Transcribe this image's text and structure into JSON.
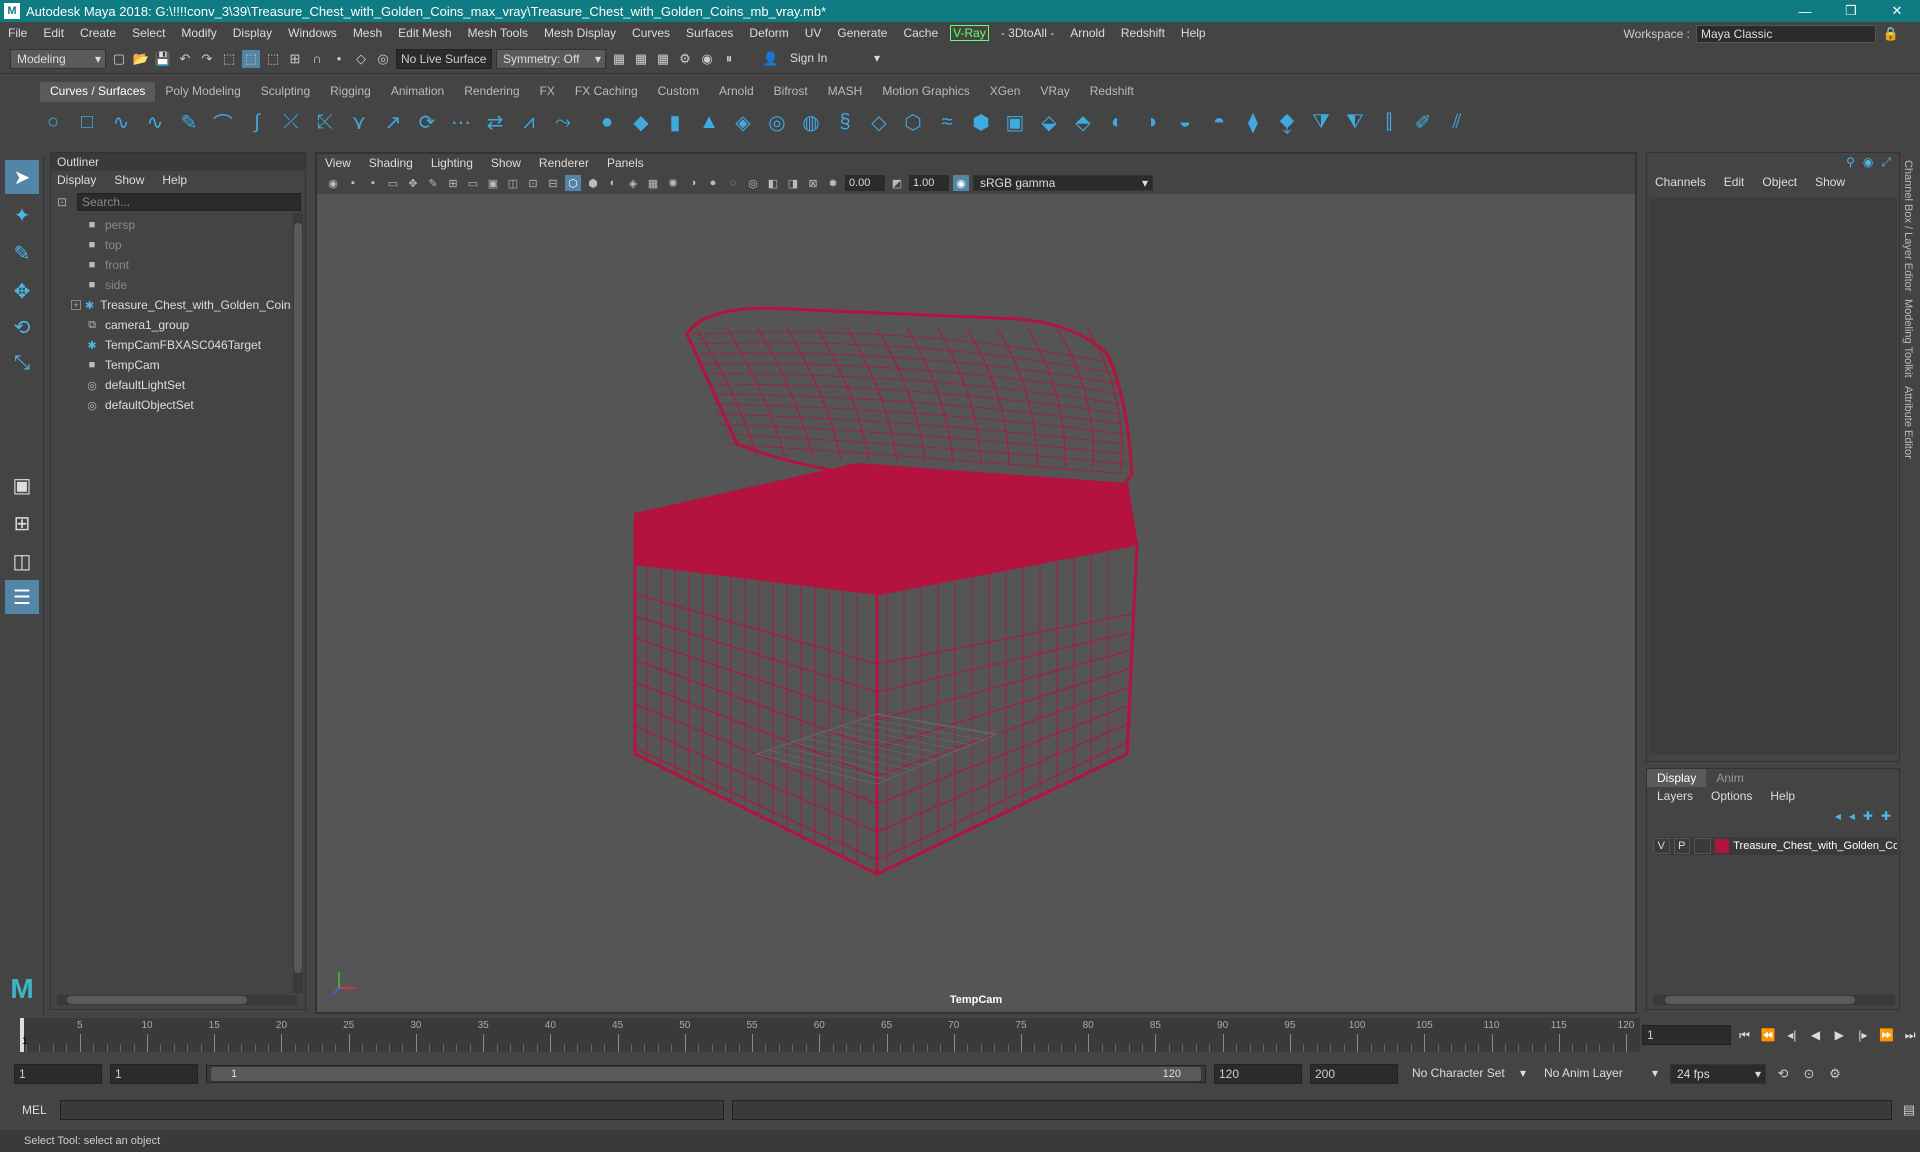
{
  "title": "Autodesk Maya 2018: G:\\!!!!conv_3\\39\\Treasure_Chest_with_Golden_Coins_max_vray\\Treasure_Chest_with_Golden_Coins_mb_vray.mb*",
  "menu": [
    "File",
    "Edit",
    "Create",
    "Select",
    "Modify",
    "Display",
    "Windows",
    "Mesh",
    "Edit Mesh",
    "Mesh Tools",
    "Mesh Display",
    "Curves",
    "Surfaces",
    "Deform",
    "UV",
    "Generate",
    "Cache",
    "V-Ray",
    "- 3DtoAll -",
    "Arnold",
    "Redshift",
    "Help"
  ],
  "workspace": {
    "label": "Workspace :",
    "value": "Maya Classic"
  },
  "status": {
    "mode": "Modeling",
    "live_surface": "No Live Surface",
    "symmetry": "Symmetry: Off",
    "sign_in": "Sign In"
  },
  "shelf_tabs": [
    "Curves / Surfaces",
    "Poly Modeling",
    "Sculpting",
    "Rigging",
    "Animation",
    "Rendering",
    "FX",
    "FX Caching",
    "Custom",
    "Arnold",
    "Bifrost",
    "MASH",
    "Motion Graphics",
    "XGen",
    "VRay",
    "Redshift"
  ],
  "outliner": {
    "title": "Outliner",
    "menus": [
      "Display",
      "Show",
      "Help"
    ],
    "search_placeholder": "Search...",
    "items": [
      {
        "label": "persp",
        "icon": "camera-icon",
        "dim": true
      },
      {
        "label": "top",
        "icon": "camera-icon",
        "dim": true
      },
      {
        "label": "front",
        "icon": "camera-icon",
        "dim": true
      },
      {
        "label": "side",
        "icon": "camera-icon",
        "dim": true
      },
      {
        "label": "Treasure_Chest_with_Golden_Coins_r",
        "icon": "transform-icon",
        "dim": false,
        "expandable": true
      },
      {
        "label": "camera1_group",
        "icon": "group-icon",
        "dim": false
      },
      {
        "label": "TempCamFBXASC046Target",
        "icon": "transform-icon",
        "dim": false
      },
      {
        "label": "TempCam",
        "icon": "camera-icon",
        "dim": false
      },
      {
        "label": "defaultLightSet",
        "icon": "set-icon",
        "dim": false
      },
      {
        "label": "defaultObjectSet",
        "icon": "set-icon",
        "dim": false
      }
    ]
  },
  "viewport": {
    "menus": [
      "View",
      "Shading",
      "Lighting",
      "Show",
      "Renderer",
      "Panels"
    ],
    "exposure": "0.00",
    "gamma": "1.00",
    "colorspace": "sRGB gamma",
    "camera": "TempCam",
    "wire_color": "#b3133e"
  },
  "channelbox": {
    "menus": [
      "Channels",
      "Edit",
      "Object",
      "Show"
    ]
  },
  "side_tabs": [
    "Channel Box / Layer Editor",
    "Modeling Toolkit",
    "Attribute Editor"
  ],
  "layers": {
    "tabs": [
      "Display",
      "Anim"
    ],
    "menus": [
      "Layers",
      "Options",
      "Help"
    ],
    "row": {
      "v": "V",
      "p": "P",
      "name": "Treasure_Chest_with_Golden_Coins"
    }
  },
  "timeline": {
    "ticks": [
      "5",
      "10",
      "15",
      "20",
      "25",
      "30",
      "35",
      "40",
      "45",
      "50",
      "55",
      "60",
      "65",
      "70",
      "75",
      "80",
      "85",
      "90",
      "95",
      "100",
      "105",
      "110",
      "115",
      "120"
    ],
    "current": "1",
    "current_field": "1"
  },
  "range": {
    "start": "1",
    "start2": "1",
    "slider_min": "1",
    "slider_max": "120",
    "end": "120",
    "end2": "200",
    "char_set": "No Character Set",
    "anim_layer": "No Anim Layer",
    "fps": "24 fps"
  },
  "cmd": {
    "lang": "MEL"
  },
  "statusbar": "Select Tool: select an object"
}
